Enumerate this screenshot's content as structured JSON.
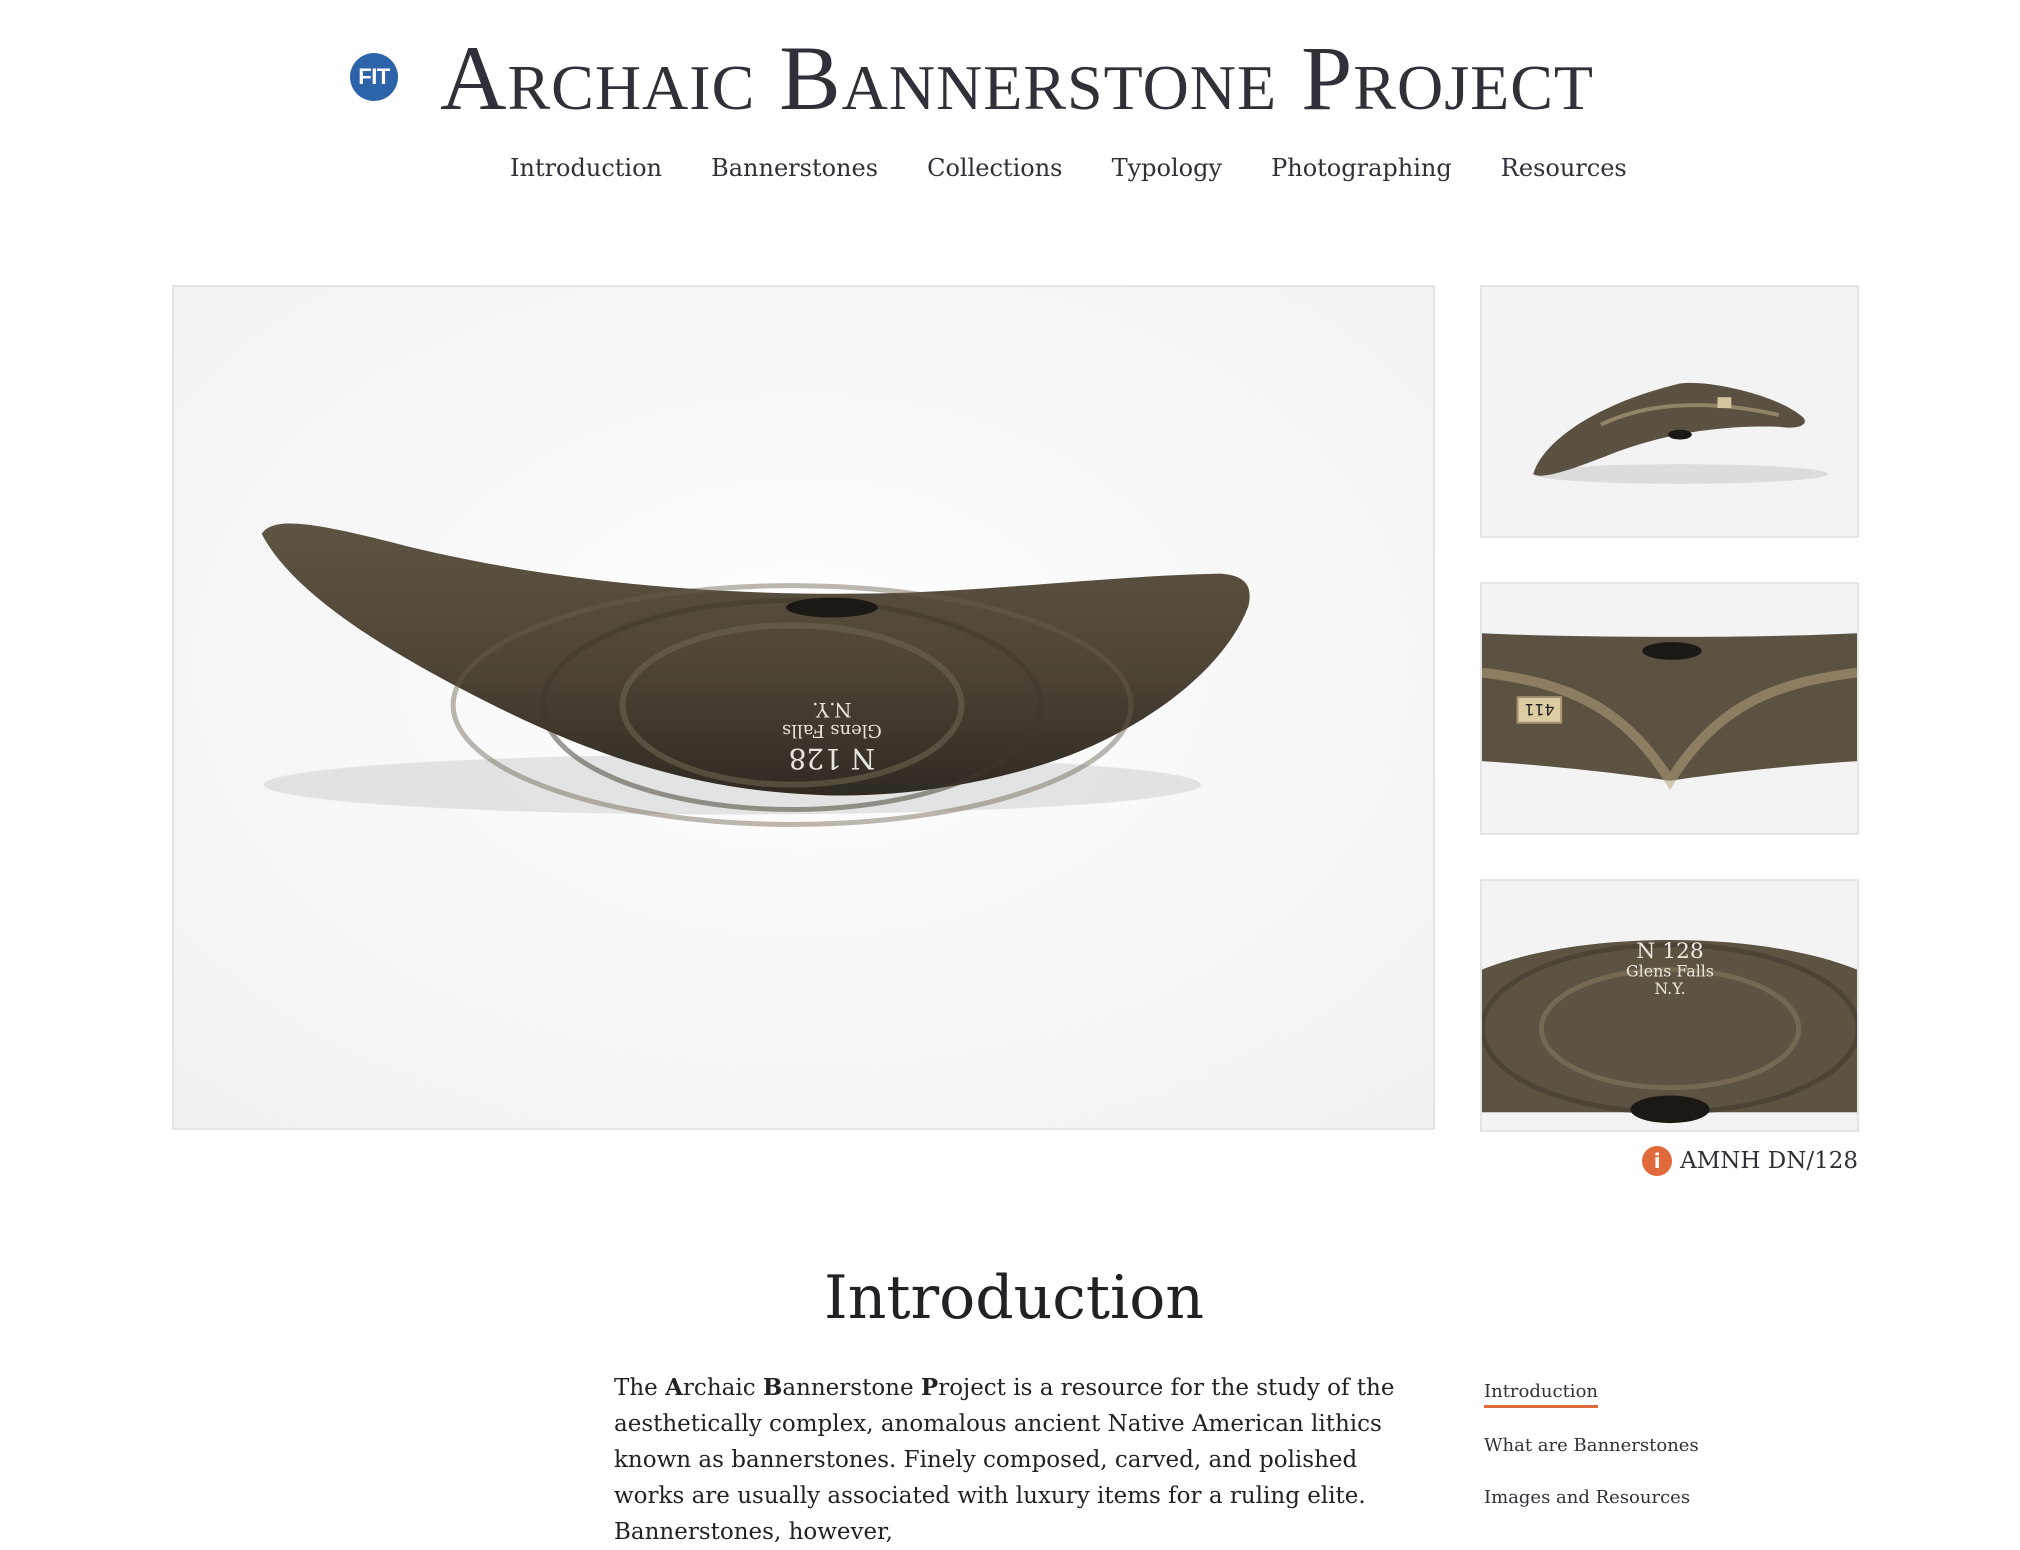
{
  "header": {
    "logo_text": "FIT",
    "title": "Archaic Bannerstone Project"
  },
  "nav": {
    "items": [
      "Introduction",
      "Bannerstones",
      "Collections",
      "Typology",
      "Photographing",
      "Resources"
    ]
  },
  "gallery": {
    "main_inscription": [
      "N.Y.",
      "Glens Falls",
      "N 128"
    ],
    "caption": "AMNH DN/128",
    "thumb_label_1": "411",
    "thumb_inscription": [
      "N 128",
      "Glens Falls",
      "N.Y."
    ]
  },
  "intro": {
    "heading": "Introduction",
    "p_the": "The ",
    "p_a1": "A",
    "p_a2": "rchaic ",
    "p_b1": "B",
    "p_b2": "annerstone ",
    "p_c1": "P",
    "p_c2": "roject is a resource for the study of the aesthetically complex, anomalous ancient Native American lithics known as bannerstones. Finely composed, carved, and polished works are usually associated with luxury items for a ruling elite. Bannerstones, however,"
  },
  "toc": {
    "items": [
      "Introduction",
      "What are Bannerstones",
      "Images and Resources"
    ]
  },
  "colors": {
    "accent": "#e06a3c",
    "logo_blue": "#2d63a8",
    "text": "#2f3038"
  }
}
